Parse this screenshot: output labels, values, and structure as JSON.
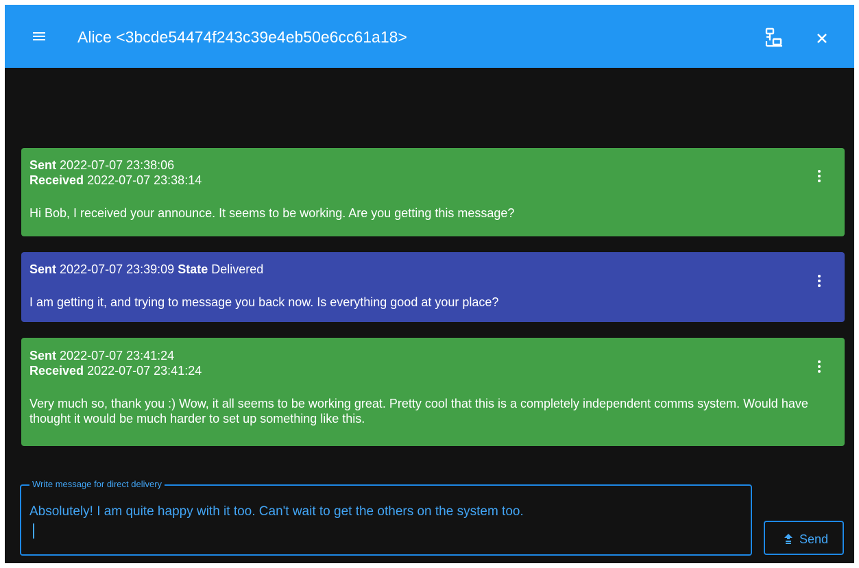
{
  "header": {
    "title": "Alice <3bcde54474f243c39e4eb50e6cc61a18>",
    "menu_icon": "hamburger-menu-icon",
    "network_icon": "network-icon",
    "close_icon": "close-icon"
  },
  "messages": [
    {
      "direction": "incoming",
      "sent_label": "Sent",
      "sent": "2022-07-07 23:38:06",
      "received_label": "Received",
      "received": "2022-07-07 23:38:14",
      "text": "Hi Bob, I received your announce. It seems to be working. Are you getting this message?"
    },
    {
      "direction": "outgoing",
      "sent_label": "Sent",
      "sent": "2022-07-07 23:39:09",
      "state_label": "State",
      "state": "Delivered",
      "text": "I am getting it, and trying to message you back now. Is everything good at your place?"
    },
    {
      "direction": "incoming",
      "sent_label": "Sent",
      "sent": "2022-07-07 23:41:24",
      "received_label": "Received",
      "received": "2022-07-07 23:41:24",
      "text": "Very much so, thank you :) Wow, it all seems to be working great. Pretty cool that this is a completely independent comms system. Would have thought it would be much harder to set up something like this."
    }
  ],
  "compose": {
    "label": "Write message for direct delivery",
    "value": "Absolutely! I am quite happy with it too. Can't wait to get the others on the system too."
  },
  "send_button": {
    "label": "Send",
    "icon": "send-icon"
  },
  "colors": {
    "header": "#2196f3",
    "background": "#121212",
    "incoming": "#43a047",
    "outgoing": "#3949ab",
    "accent": "#42a5f5"
  }
}
